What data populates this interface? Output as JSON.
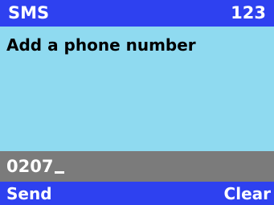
{
  "header": {
    "title": "SMS",
    "counter": "123"
  },
  "content": {
    "prompt": "Add a phone number"
  },
  "input": {
    "value": "0207"
  },
  "softkeys": {
    "left": "Send",
    "right": "Clear"
  },
  "colors": {
    "bar": "#2e41f0",
    "content_bg": "#8fdaf0",
    "input_bg": "#7b7b7b",
    "bar_text": "#ffffff",
    "content_text": "#000000"
  }
}
